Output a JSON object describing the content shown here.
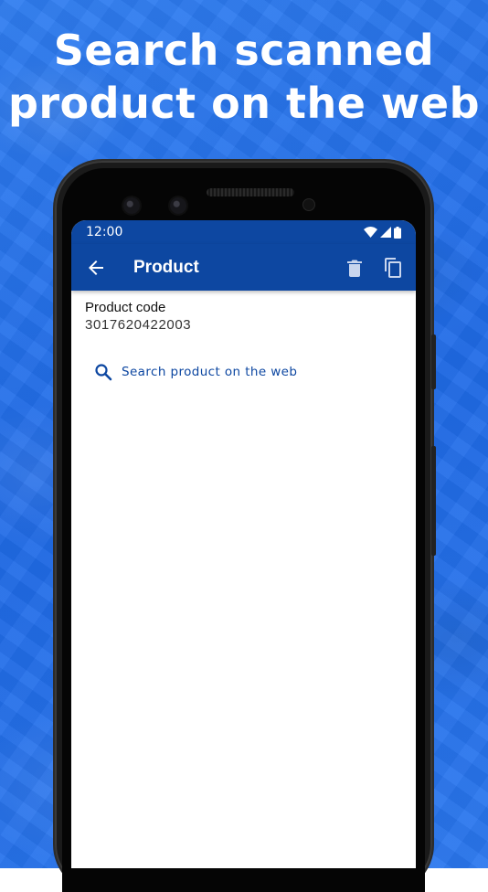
{
  "headline": {
    "line1": "Search scanned",
    "line2": "product on the web"
  },
  "statusbar": {
    "time": "12:00",
    "icons": [
      "wifi-icon",
      "signal-icon",
      "battery-icon"
    ]
  },
  "appbar": {
    "title": "Product",
    "back_icon": "arrow-back-icon",
    "actions": [
      "delete-icon",
      "copy-icon"
    ]
  },
  "product": {
    "code_label": "Product code",
    "code_value": "3017620422003"
  },
  "search_link": {
    "label": "Search product on the web",
    "icon": "search-icon"
  },
  "colors": {
    "background": "#2a74ec",
    "appbar": "#0d47a1",
    "link": "#0d47a1"
  }
}
